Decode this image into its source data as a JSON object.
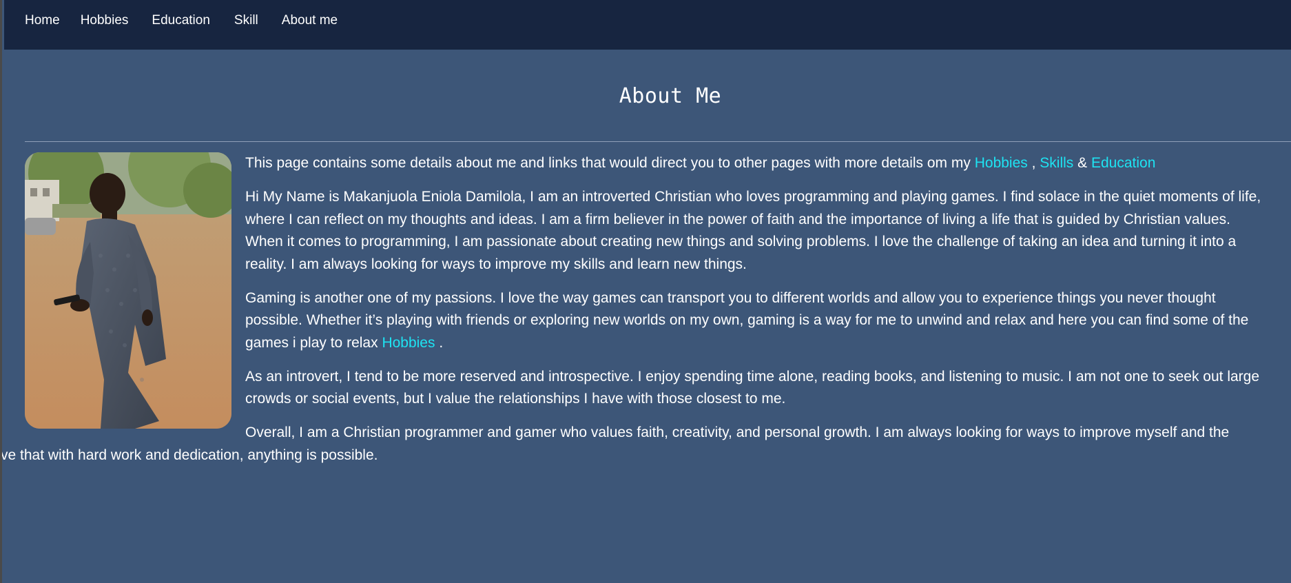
{
  "nav": {
    "items": [
      {
        "label": "Home"
      },
      {
        "label": "Hobbies"
      },
      {
        "label": "Education"
      },
      {
        "label": "Skill"
      },
      {
        "label": "About me"
      }
    ]
  },
  "main": {
    "title": "About Me",
    "photo_alt": "Photo of Makanjuola Eniola Damilola",
    "intro": {
      "text_before": "This page contains some details about me and links that would direct you to other pages with more details om my ",
      "link_hobbies": "Hobbies",
      "sep1": " , ",
      "link_skills": "Skills",
      "sep2": " & ",
      "link_education": "Education"
    },
    "para1_lines": [
      "Hi My Name is Makanjuola Eniola Damilola, I am an introverted Christian who loves programming and playing games. I find solace in the quiet moments of life,",
      "where I can reflect on my thoughts and ideas. I am a firm believer in the power of faith and the importance of living a life that is guided by Christian values.",
      "When it comes to programming, I am passionate about creating new things and solving problems. I love the challenge of taking an idea and turning it into a",
      "reality. I am always looking for ways to improve my skills and learn new things."
    ],
    "para2_lines": [
      "Gaming is another one of my passions. I love the way games can transport you to different worlds and allow you to experience things you never thought",
      "possible. Whether it’s playing with friends or exploring new worlds on my own, gaming is a way for me to unwind and relax and here you can find some of the"
    ],
    "para2_last_before": "games i play to relax ",
    "para2_link": "Hobbies",
    "para2_last_after": " .",
    "para3_lines": [
      "As an introvert, I tend to be more reserved and introspective. I enjoy spending time alone, reading books, and listening to music. I am not one to seek out large",
      "crowds or social events, but I value the relationships I have with those closest to me."
    ],
    "para4_lines": [
      "Overall, I am a Christian programmer and gamer who values faith, creativity, and personal growth. I am always looking for ways to improve myself and the",
      "world around me, and I believe that with hard work and dedication, anything is possible."
    ]
  },
  "colors": {
    "navbar_bg": "#172540",
    "page_bg": "#3d5678",
    "link": "#1ee3f2",
    "text": "#ffffff"
  }
}
